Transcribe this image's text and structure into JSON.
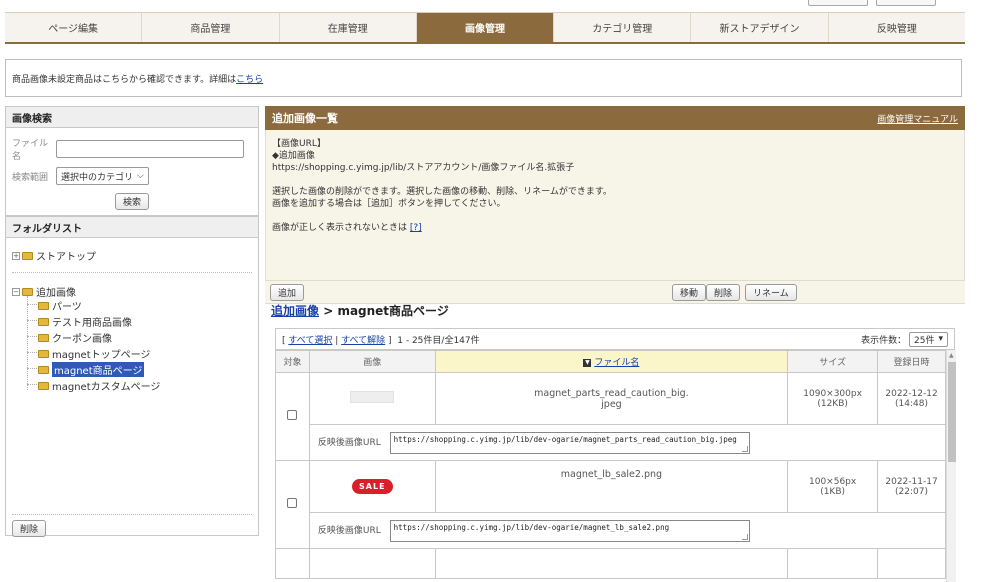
{
  "nav": {
    "tabs": [
      {
        "label": "ページ編集",
        "active": false
      },
      {
        "label": "商品管理",
        "active": false
      },
      {
        "label": "在庫管理",
        "active": false
      },
      {
        "label": "画像管理",
        "active": true
      },
      {
        "label": "カテゴリ管理",
        "active": false
      },
      {
        "label": "新ストアデザイン",
        "active": false
      },
      {
        "label": "反映管理",
        "active": false
      }
    ]
  },
  "notice": {
    "text": "商品画像未設定商品はこちらから確認できます。詳細は",
    "link": "こちら"
  },
  "search": {
    "title": "画像検索",
    "filename_label": "ファイル名",
    "filename_value": "",
    "scope_label": "検索範囲",
    "scope_value": "選択中のカテゴリ",
    "search_button": "検索"
  },
  "folders": {
    "title": "フォルダリスト",
    "store_top": "ストアトップ",
    "added_images": "追加画像",
    "children": [
      "パーツ",
      "テスト用商品画像",
      "クーポン画像",
      "magnetトップページ",
      "magnet商品ページ",
      "magnetカスタムページ"
    ],
    "selected": "magnet商品ページ",
    "delete_button": "削除"
  },
  "main": {
    "title": "追加画像一覧",
    "manual_link": "画像管理マニュアル",
    "info": {
      "line1": "【画像URL】",
      "line2": "◆追加画像",
      "line3": "https://shopping.c.yimg.jp/lib/ストアアカウント/画像ファイル名.拡張子",
      "line4": "選択した画像の削除ができます。選択した画像の移動、削除、リネームができます。",
      "line5": "画像を追加する場合は［追加］ボタンを押してください。",
      "line6": "画像が正しく表示されないときは",
      "help_link": "[?]"
    },
    "toolbar": {
      "add": "追加",
      "move": "移動",
      "delete": "削除",
      "rename": "リネーム"
    },
    "breadcrumb": {
      "parent": "追加画像",
      "separator": " > ",
      "current": "magnet商品ページ"
    },
    "list": {
      "select_all": "すべて選択",
      "deselect_all": "すべて解除",
      "range": "1 - 25件目/全147件",
      "per_page_label": "表示件数：",
      "per_page_value": "25件"
    },
    "columns": {
      "target": "対象",
      "image": "画像",
      "filename": "ファイル名",
      "size": "サイズ",
      "date": "登録日時"
    },
    "url_label": "反映後画像URL",
    "rows": [
      {
        "filename": "magnet_parts_read_caution_big.jpeg",
        "filename_l1": "magnet_parts_read_caution_big.",
        "filename_l2": "jpeg",
        "dims": "1090×300px",
        "kb": "(12KB)",
        "date": "2022-12-12",
        "time": "(14:48)",
        "url": "https://shopping.c.yimg.jp/lib/dev-ogarie/magnet_parts_read_caution_big.jpeg"
      },
      {
        "filename": "magnet_lb_sale2.png",
        "badge": "SALE",
        "dims": "100×56px",
        "kb": "(1KB)",
        "date": "2022-11-17",
        "time": "(22:07)",
        "url": "https://shopping.c.yimg.jp/lib/dev-ogarie/magnet_lb_sale2.png"
      }
    ]
  },
  "colors": {
    "accent": "#8b6a3e",
    "link": "#1a3fa8",
    "selected": "#2f5bb7",
    "sale": "#d9202a"
  }
}
